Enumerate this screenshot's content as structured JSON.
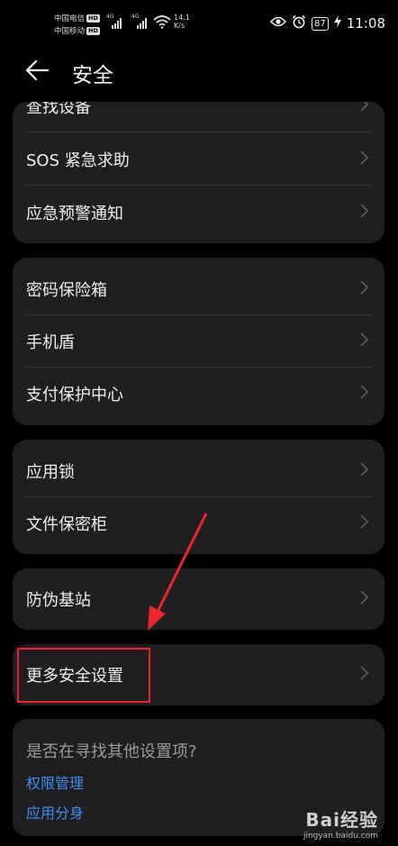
{
  "status_bar": {
    "carrier1": "中国电信",
    "carrier2": "中国移动",
    "hd_label": "HD",
    "net1": "4G",
    "net2": "4G",
    "speed_value": "14.1",
    "speed_unit": "K/s",
    "battery": "87",
    "time": "11:08",
    "icons": [
      "signal-icon",
      "wifi-icon",
      "eye-icon",
      "alarm-icon",
      "battery-icon",
      "charging-icon"
    ]
  },
  "header": {
    "title": "安全",
    "back_icon": "arrow-left-icon"
  },
  "groups": [
    {
      "items": [
        {
          "label": "查找设备"
        },
        {
          "label": "SOS 紧急求助"
        },
        {
          "label": "应急预警通知"
        }
      ]
    },
    {
      "items": [
        {
          "label": "密码保险箱"
        },
        {
          "label": "手机盾"
        },
        {
          "label": "支付保护中心"
        }
      ]
    },
    {
      "items": [
        {
          "label": "应用锁"
        },
        {
          "label": "文件保密柜"
        }
      ]
    },
    {
      "items": [
        {
          "label": "防伪基站"
        }
      ]
    },
    {
      "items": [
        {
          "label": "更多安全设置"
        }
      ]
    }
  ],
  "suggestions": {
    "question": "是否在寻找其他设置项?",
    "links": [
      "权限管理",
      "应用分身"
    ]
  },
  "annotation": {
    "highlight_color": "#e8262b"
  },
  "watermark": {
    "logo": "Bai经验",
    "url": "jingyan.baidu.com"
  },
  "colors": {
    "background": "#000000",
    "card": "#1f1f21",
    "link": "#3f8ff2"
  }
}
